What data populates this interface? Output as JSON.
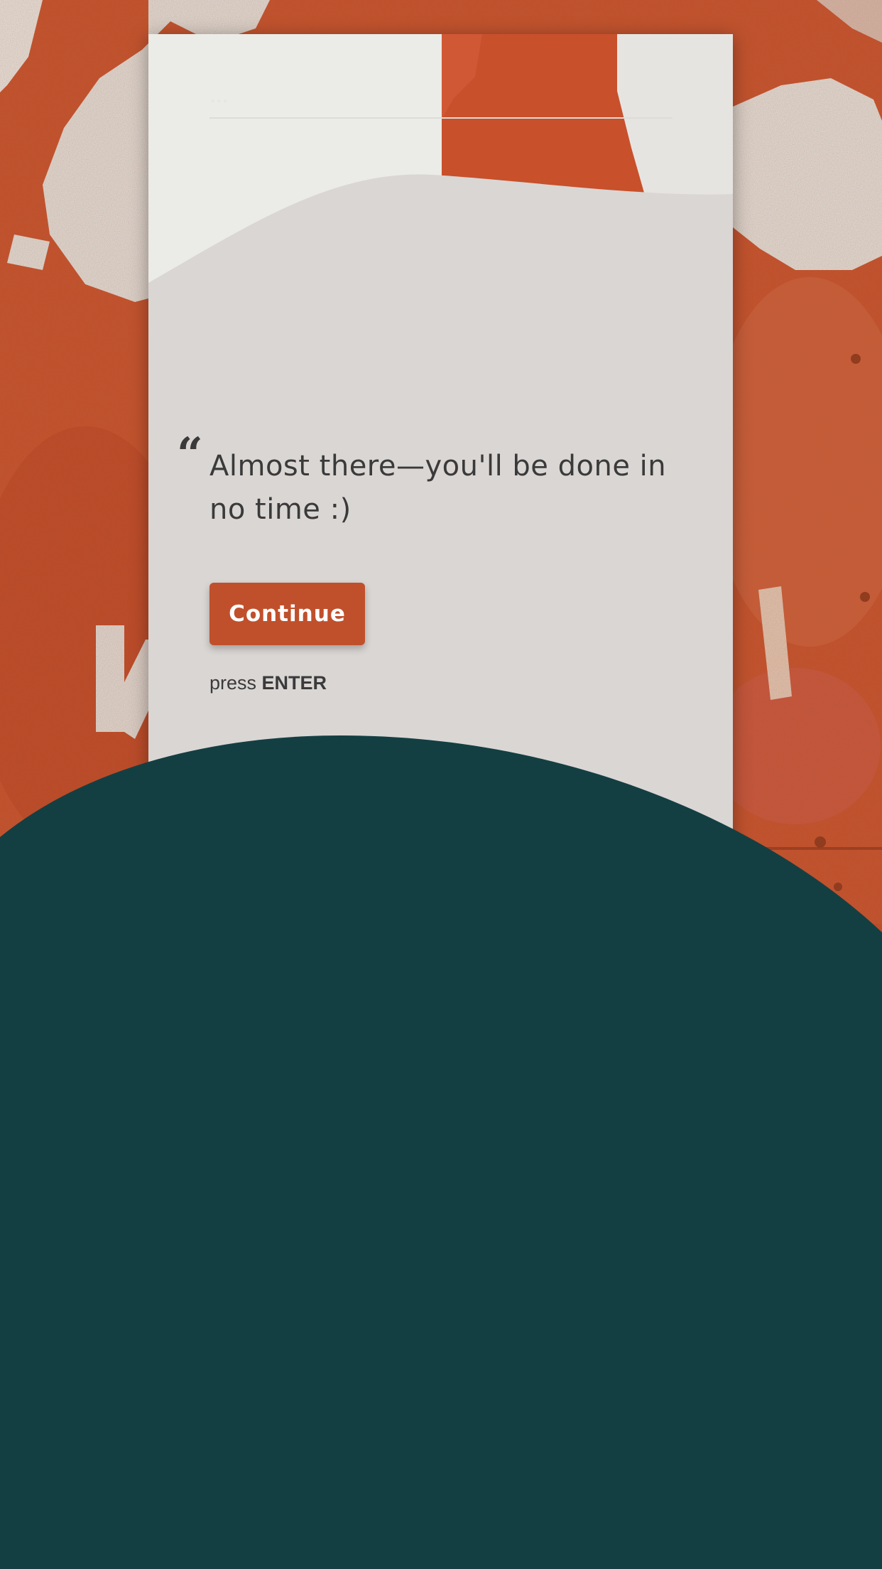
{
  "form": {
    "quote_icon": "quote-icon",
    "message": "Almost there—you'll be done in no time :)",
    "continue_label": "Continue",
    "hint_prefix": "press",
    "hint_key": "ENTER"
  },
  "colors": {
    "background_rust": "#c24a26",
    "card": "#dad6d4",
    "button": "#c0502c",
    "text": "#3a3a3a",
    "teal_shape": "#143f42"
  }
}
